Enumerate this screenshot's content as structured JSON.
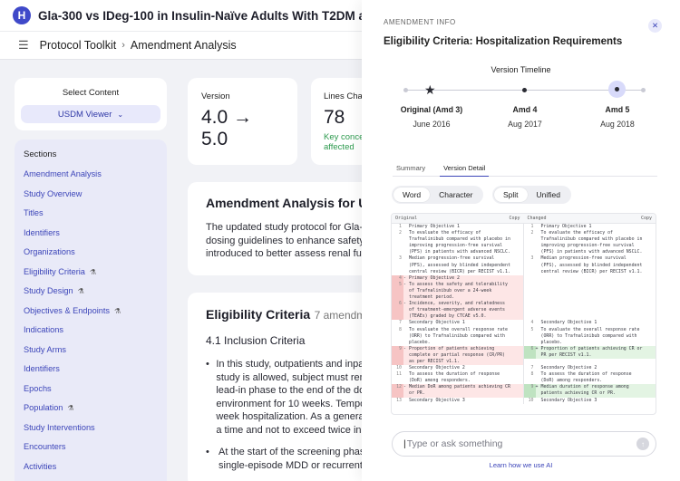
{
  "app": {
    "logo_letter": "H",
    "document_title": "Gla-300 vs IDeg-100 in Insulin-Naïve Adults With T2DM and Renal Impairment"
  },
  "breadcrumb": {
    "root": "Protocol Toolkit",
    "current": "Amendment Analysis"
  },
  "sidebar": {
    "select_label": "Select Content",
    "viewer_label": "USDM Viewer",
    "sections_title": "Sections",
    "items": [
      {
        "label": "Amendment Analysis",
        "icon": ""
      },
      {
        "label": "Study Overview",
        "icon": ""
      },
      {
        "label": "Titles",
        "icon": ""
      },
      {
        "label": "Identifiers",
        "icon": ""
      },
      {
        "label": "Organizations",
        "icon": ""
      },
      {
        "label": "Eligibility Criteria",
        "icon": "⚗"
      },
      {
        "label": "Study Design",
        "icon": "⚗"
      },
      {
        "label": "Objectives & Endpoints",
        "icon": "⚗"
      },
      {
        "label": "Indications",
        "icon": ""
      },
      {
        "label": "Study Arms",
        "icon": ""
      },
      {
        "label": "Identifiers",
        "icon": ""
      },
      {
        "label": "Epochs",
        "icon": ""
      },
      {
        "label": "Population",
        "icon": "⚗"
      },
      {
        "label": "Study Interventions",
        "icon": ""
      },
      {
        "label": "Encounters",
        "icon": ""
      },
      {
        "label": "Activities",
        "icon": ""
      }
    ]
  },
  "metrics": {
    "version": {
      "label": "Version",
      "value_line1": "4.0 →",
      "value_line2": "5.0"
    },
    "lines_changed": {
      "label": "Lines Chan",
      "value": "78",
      "sub_line1": "Key conce",
      "sub_line2": "affected"
    }
  },
  "analysis": {
    "title": "Amendment Analysis for USDM",
    "lines": [
      "The updated study protocol for Gla-300",
      "dosing guidelines to enhance safety ar",
      "introduced to better assess renal func"
    ]
  },
  "eligibility": {
    "title": "Eligibility Criteria",
    "count": "7 amendment",
    "subtitle": "4.1 Inclusion Criteria",
    "bullet1": [
      "In this study, outpatients and inpati",
      "study is allowed, subject must rema",
      "lead-in phase to the end of the dou",
      "environment for 10 weeks. Tempora",
      "week hospitalization. As a general r",
      "a time and not to exceed twice in 7"
    ],
    "bullet2": [
      "At the start of the screening phase",
      "single-episode MDD or recurrent M"
    ]
  },
  "drawer": {
    "kicker": "AMENDMENT INFO",
    "title": "Eligibility Criteria: Hospitalization Requirements",
    "timeline_title": "Version Timeline",
    "versions": [
      {
        "name": "Original (Amd 3)",
        "date": "June 2016"
      },
      {
        "name": "Amd 4",
        "date": "Aug 2017"
      },
      {
        "name": "Amd 5",
        "date": "Aug 2018"
      }
    ],
    "tabs": [
      "Summary",
      "Version Detail"
    ],
    "mode_toggle": [
      "Word",
      "Character"
    ],
    "view_toggle": [
      "Split",
      "Unified"
    ],
    "diff_original_label": "Original",
    "diff_changed_label": "Changed",
    "copy_label": "Copy",
    "input_placeholder": "Type or ask something",
    "learn_link": "Learn how we use AI"
  },
  "diff": {
    "left": [
      {
        "n": "1",
        "s": "",
        "t": "Primary Objective 1",
        "k": ""
      },
      {
        "n": "2",
        "s": "",
        "t": "To evaluate the efficacy of",
        "k": ""
      },
      {
        "n": "",
        "s": "",
        "t": "Trafnalinibub compared with placebo in",
        "k": ""
      },
      {
        "n": "",
        "s": "",
        "t": "improving progression-free survival",
        "k": ""
      },
      {
        "n": "",
        "s": "",
        "t": "(PFS) in patients with advanced NSCLC.",
        "k": ""
      },
      {
        "n": "3",
        "s": "",
        "t": "Median progression-free survival",
        "k": ""
      },
      {
        "n": "",
        "s": "",
        "t": "(PFS), assessed by blinded independent",
        "k": ""
      },
      {
        "n": "",
        "s": "",
        "t": "central review (BICR) per RECIST v1.1.",
        "k": ""
      },
      {
        "n": "4",
        "s": "-",
        "t": "Primary Objective 2",
        "k": "del"
      },
      {
        "n": "5",
        "s": "-",
        "t": "To assess the safety and tolerability",
        "k": "del"
      },
      {
        "n": "",
        "s": "",
        "t": "of Trafnalinibub over a 24-week",
        "k": "del"
      },
      {
        "n": "",
        "s": "",
        "t": "treatment period.",
        "k": "del"
      },
      {
        "n": "6",
        "s": "-",
        "t": "Incidence, severity, and relatedness",
        "k": "del"
      },
      {
        "n": "",
        "s": "",
        "t": "of treatment-emergent adverse events",
        "k": "del"
      },
      {
        "n": "",
        "s": "",
        "t": "(TEAEs) graded by CTCAE v5.0.",
        "k": "del"
      },
      {
        "n": "7",
        "s": "",
        "t": "Secondary Objective 1",
        "k": ""
      },
      {
        "n": "8",
        "s": "",
        "t": "To evaluate the overall response rate",
        "k": ""
      },
      {
        "n": "",
        "s": "",
        "t": "(ORR) to Trafnalinibub compared with",
        "k": ""
      },
      {
        "n": "",
        "s": "",
        "t": "placebo.",
        "k": ""
      },
      {
        "n": "9",
        "s": "-",
        "t": "Proportion of patients achieving",
        "k": "del"
      },
      {
        "n": "",
        "s": "",
        "t": "complete or partial response (CR/PR)",
        "k": "del"
      },
      {
        "n": "",
        "s": "",
        "t": "as per RECIST v1.1.",
        "k": "del"
      },
      {
        "n": "10",
        "s": "",
        "t": "Secondary Objective 2",
        "k": ""
      },
      {
        "n": "11",
        "s": "",
        "t": "To assess the duration of response",
        "k": ""
      },
      {
        "n": "",
        "s": "",
        "t": "(DoR) among responders.",
        "k": ""
      },
      {
        "n": "12",
        "s": "-",
        "t": "Median DoR among patients achieving CR",
        "k": "del"
      },
      {
        "n": "",
        "s": "",
        "t": "or PR.",
        "k": "del"
      },
      {
        "n": "13",
        "s": "",
        "t": "Secondary Objective 3",
        "k": ""
      }
    ],
    "right": [
      {
        "n": "1",
        "s": "",
        "t": "Primary Objective 1",
        "k": ""
      },
      {
        "n": "2",
        "s": "",
        "t": "To evaluate the efficacy of",
        "k": ""
      },
      {
        "n": "",
        "s": "",
        "t": "Trafnalinibub compared with placebo in",
        "k": ""
      },
      {
        "n": "",
        "s": "",
        "t": "improving progression-free survival",
        "k": ""
      },
      {
        "n": "",
        "s": "",
        "t": "(PFS) in patients with advanced NSCLC.",
        "k": ""
      },
      {
        "n": "3",
        "s": "",
        "t": "Median progression-free survival",
        "k": ""
      },
      {
        "n": "",
        "s": "",
        "t": "(PFS), assessed by blinded independent",
        "k": ""
      },
      {
        "n": "",
        "s": "",
        "t": "central review (BICR) per RECIST v1.1.",
        "k": ""
      },
      {
        "n": "",
        "s": "",
        "t": "",
        "k": ""
      },
      {
        "n": "",
        "s": "",
        "t": "",
        "k": ""
      },
      {
        "n": "",
        "s": "",
        "t": "",
        "k": ""
      },
      {
        "n": "",
        "s": "",
        "t": "",
        "k": ""
      },
      {
        "n": "",
        "s": "",
        "t": "",
        "k": ""
      },
      {
        "n": "",
        "s": "",
        "t": "",
        "k": ""
      },
      {
        "n": "",
        "s": "",
        "t": "",
        "k": ""
      },
      {
        "n": "4",
        "s": "",
        "t": "Secondary Objective 1",
        "k": ""
      },
      {
        "n": "5",
        "s": "",
        "t": "To evaluate the overall response rate",
        "k": ""
      },
      {
        "n": "",
        "s": "",
        "t": "(ORR) to Trafnalinibub compared with",
        "k": ""
      },
      {
        "n": "",
        "s": "",
        "t": "placebo.",
        "k": ""
      },
      {
        "n": "6",
        "s": "+",
        "t": "Proportion of patients achieving CR or",
        "k": "add"
      },
      {
        "n": "",
        "s": "",
        "t": "PR per RECIST v1.1.",
        "k": "add"
      },
      {
        "n": "",
        "s": "",
        "t": "",
        "k": ""
      },
      {
        "n": "7",
        "s": "",
        "t": "Secondary Objective 2",
        "k": ""
      },
      {
        "n": "8",
        "s": "",
        "t": "To assess the duration of response",
        "k": ""
      },
      {
        "n": "",
        "s": "",
        "t": "(DoR) among responders.",
        "k": ""
      },
      {
        "n": "9",
        "s": "+",
        "t": "Median duration of response among",
        "k": "add"
      },
      {
        "n": "",
        "s": "",
        "t": "patients achieving CR or PR.",
        "k": "add"
      },
      {
        "n": "10",
        "s": "",
        "t": "Secondary Objective 3",
        "k": ""
      }
    ]
  }
}
